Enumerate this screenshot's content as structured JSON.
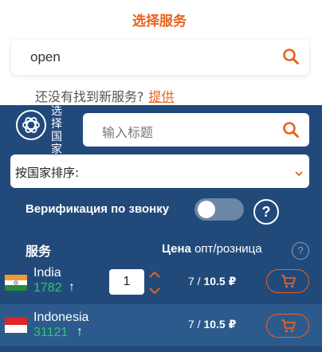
{
  "header": {
    "title": "选择服务"
  },
  "service_search": {
    "value": "open"
  },
  "not_found": {
    "text": "还没有找到新服务?",
    "link": "提供"
  },
  "panel": {
    "vertical_label": "选择国家",
    "country_search": {
      "placeholder": "输入标题"
    },
    "sort_select": {
      "value": "按国家排序:"
    },
    "verification": {
      "label": "Верификация по звонку",
      "toggle_on": false,
      "help": "?"
    },
    "table_header": {
      "service": "服务",
      "price_bold": "Цена",
      "price_rest": "опт/розница",
      "help": "?"
    }
  },
  "rows": [
    {
      "country": "India",
      "count": "1782",
      "arrow": "↑",
      "qty": "1",
      "price_opt": "7",
      "price_retail": "10.5",
      "currency": "₽"
    },
    {
      "country": "Indonesia",
      "count": "31121",
      "arrow": "↑",
      "price_opt": "7",
      "price_retail": "10.5",
      "currency": "₽"
    }
  ],
  "colors": {
    "accent": "#e8631c",
    "panel": "#214a7b",
    "count_green": "#28c76f"
  }
}
